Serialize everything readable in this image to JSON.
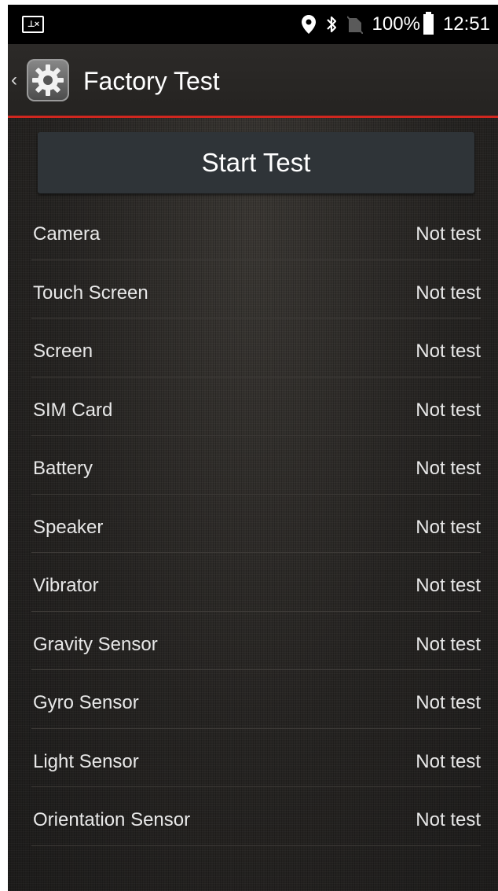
{
  "status_bar": {
    "notification_icon": "blocked-contact-icon",
    "icons": [
      "location-icon",
      "bluetooth-icon",
      "no-sim-icon"
    ],
    "battery_percent": "100%",
    "battery_icon": "battery-full-icon",
    "time": "12:51"
  },
  "action_bar": {
    "back_icon": "chevron-left-icon",
    "app_icon": "gear-icon",
    "title": "Factory Test"
  },
  "start_button": {
    "label": "Start Test"
  },
  "tests": [
    {
      "name": "Camera",
      "status": "Not test"
    },
    {
      "name": "Touch Screen",
      "status": "Not test"
    },
    {
      "name": "Screen",
      "status": "Not test"
    },
    {
      "name": "SIM Card",
      "status": "Not test"
    },
    {
      "name": "Battery",
      "status": "Not test"
    },
    {
      "name": "Speaker",
      "status": "Not test"
    },
    {
      "name": "Vibrator",
      "status": "Not test"
    },
    {
      "name": "Gravity Sensor",
      "status": "Not test"
    },
    {
      "name": "Gyro Sensor",
      "status": "Not test"
    },
    {
      "name": "Light Sensor",
      "status": "Not test"
    },
    {
      "name": "Orientation Sensor",
      "status": "Not test"
    }
  ],
  "colors": {
    "accent": "#d0271f",
    "button_bg": "#2f3438",
    "text": "#e8e8e8"
  }
}
